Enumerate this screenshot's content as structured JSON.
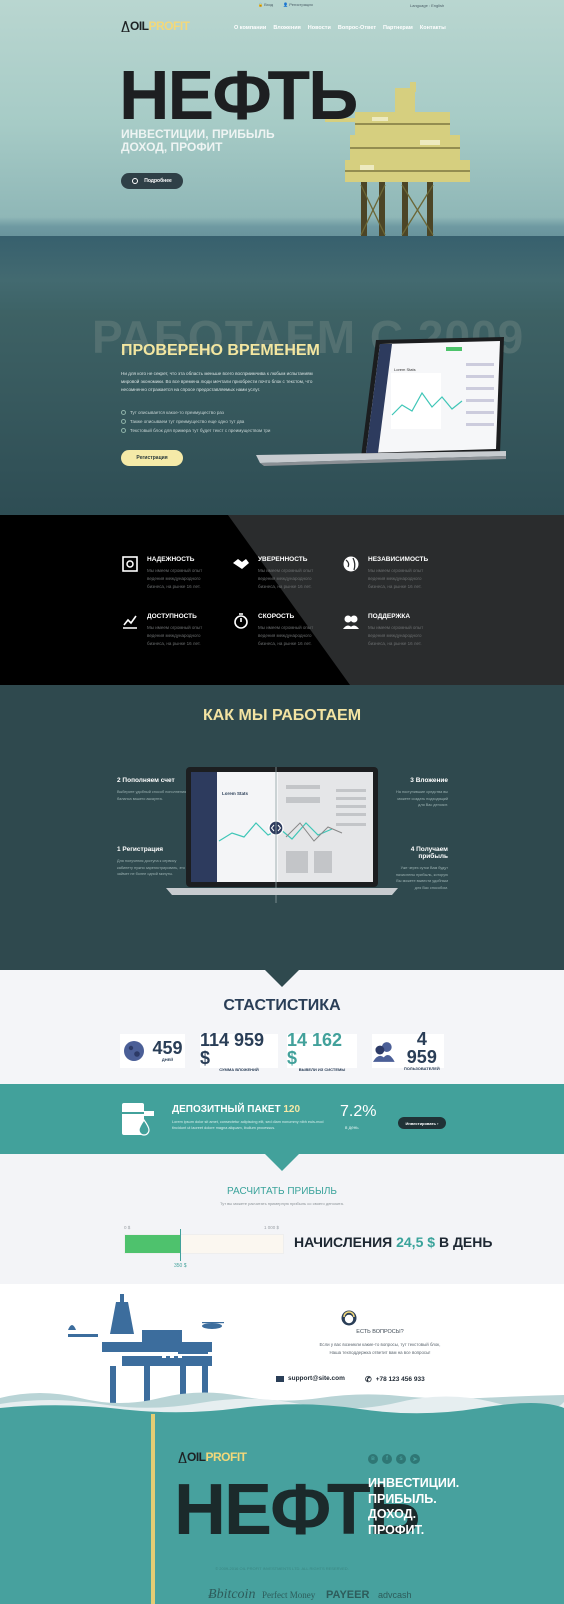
{
  "topbar": {
    "items": [
      "Вход",
      "Регистрация"
    ],
    "language": "Language : English"
  },
  "logo": {
    "oil": "OIL",
    "profit": "PROFIT"
  },
  "nav": {
    "items": [
      "О компании",
      "Вложения",
      "Новости",
      "Вопрос-Ответ",
      "Партнерам",
      "Контакты"
    ]
  },
  "hero": {
    "title": "НЕФТЬ",
    "subtitle_1": "ИНВЕСТИЦИИ, ПРИБЫЛЬ",
    "subtitle_2": "ДОХОД, ПРОФИТ",
    "more_button": "Подробнее"
  },
  "proven": {
    "bg_text": "РАБОТАЕМ С 2009",
    "title": "ПРОВЕРЕНО ВРЕМЕНЕМ",
    "text": "Ни для кого не секрет, что эта область меньше всего восприимчива к любым испытаниям мировой экономики. Во все времена люди мечтали приобрести почто блок с текстом, что несомненно отражается на спросе предоставляемых нами услуг.",
    "list": [
      "Тут описывается какое-то преимущество раз",
      "Также описываем тут преимущество еще одно тут два",
      "Текстовый блок для примера тут будет текст с преимуществом три"
    ],
    "register_button": "Регистрация",
    "dash_title": "Lorem Stats"
  },
  "features": [
    {
      "title": "НАДЕЖНОСТЬ",
      "text": "Мы имеем огромный опыт ведения международного бизнеса, на рынке 16 лет.",
      "icon": "safe-icon"
    },
    {
      "title": "УВЕРЕННОСТЬ",
      "text": "Мы имеем огромный опыт ведения международного бизнеса, на рынке 16 лет.",
      "icon": "handshake-icon"
    },
    {
      "title": "НЕЗАВИСИМОСТЬ",
      "text": "Мы имеем огромный опыт ведения международного бизнеса, на рынке 16 лет.",
      "icon": "globe-icon"
    },
    {
      "title": "ДОСТУПНОСТЬ",
      "text": "Мы имеем огромный опыт ведения международного бизнеса, на рынке 16 лет.",
      "icon": "chart-icon"
    },
    {
      "title": "СКОРОСТЬ",
      "text": "Мы имеем огромный опыт ведения международного бизнеса, на рынке 16 лет.",
      "icon": "stopwatch-icon"
    },
    {
      "title": "ПОДДЕРЖКА",
      "text": "Мы имеем огромный опыт ведения международного бизнеса, на рынке 16 лет.",
      "icon": "support-icon"
    }
  ],
  "how": {
    "title": "КАК МЫ РАБОТАЕМ",
    "steps": [
      {
        "title": "2 Пополняем счет",
        "text": "Выберите удобный способ пополнения баланса вашего аккаунта."
      },
      {
        "title": "3 Вложение",
        "text": "На поступившие средства вы можете создать подходящий для Вас депозит."
      },
      {
        "title": "1 Регистрация",
        "text": "Для получения доступа к сервису кабинету нужно зарегистрировать, это займет не более одной минуты."
      },
      {
        "title": "4 Получаем прибыль",
        "text": "Уже через сутки Вам будут начислены прибыль, которую Вы можете вывести удобным для Вас способом."
      }
    ],
    "laptop_title": "Lorem Stats"
  },
  "stats": {
    "title": "СТАСТИСТИКА",
    "items": [
      {
        "value": "459",
        "label": "ДНЕЙ",
        "icon": "planet-icon"
      },
      {
        "value": "114 959 $",
        "label": "СУММА ВЛОЖЕНИЙ",
        "icon": ""
      },
      {
        "value": "14 162 $",
        "label": "ВЫВЕЛИ ИЗ СИСТЕМЫ",
        "icon": ""
      },
      {
        "value": "4 959",
        "label": "ПОЛЬЗОВАТЕЛЕЙ",
        "icon": "users-icon"
      }
    ]
  },
  "deposit": {
    "title": "ДЕПОЗИТНЫЙ ПАКЕТ",
    "number": "120",
    "text": "Lorem ipsum dolor sit amet, consectetur adipiscing elit, sed diam nonummy nibh euis-mod tincidunt ut laoreet dolore magna aliquam, ibullum processus.",
    "percent": "7.2%",
    "per_day": "в день",
    "button": "Инвестировать"
  },
  "calc": {
    "title": "РАСЧИТАТЬ ПРИБЫЛЬ",
    "subtitle": "Тут вы можете расчитать примерную прибыль со своего депозита.",
    "min": "0 $",
    "max": "1 000 $",
    "value": "350 $",
    "daily_prefix": "НАЧИСЛЕНИЯ",
    "daily_amount": "24,5 $",
    "daily_suffix": "В ДЕНЬ",
    "fill": 0.35
  },
  "contact": {
    "question": "ЕСТЬ ВОПРОСЫ?",
    "text_1": "Если у вас возникли какие-то вопросы, тут текстовый блок,",
    "text_2": "Наша техподдержка ответит вам на все вопросы!",
    "email": "support@site.com",
    "phone": "+78 123 456 933"
  },
  "footer": {
    "title": "НЕФТЬ",
    "sub": [
      "ИНВЕСТИЦИИ.",
      "ПРИБЫЛЬ.",
      "ДОХОД.",
      "ПРОФИТ."
    ],
    "copyright": "© 2009-2016 OIL PROFIT INVESTMENTS LTD. ALL RIGHTS RESERVED.",
    "payments": [
      "bitcoin",
      "Perfect Money",
      "PAYEER",
      "advcash"
    ],
    "social": [
      "vk-icon",
      "facebook-icon",
      "skype-icon",
      "telegram-icon"
    ]
  }
}
